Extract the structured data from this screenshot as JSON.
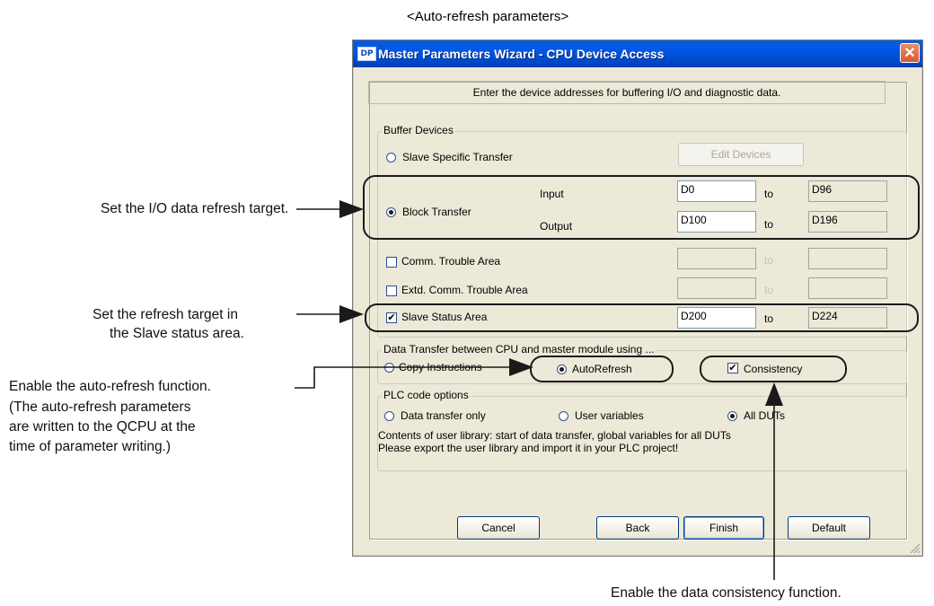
{
  "caption_top": "<Auto-refresh parameters>",
  "annotations": {
    "io_refresh": "Set the I/O data refresh target.",
    "slave_status_1": "Set the refresh target in",
    "slave_status_2": "the Slave status area.",
    "autorefresh_1": "Enable the auto-refresh function.",
    "autorefresh_2": "(The auto-refresh parameters",
    "autorefresh_3": "are written to the QCPU at the",
    "autorefresh_4": "time of parameter writing.)",
    "consistency": "Enable the data consistency function."
  },
  "window": {
    "badge": "DP",
    "title": "Master Parameters Wizard - CPU Device Access",
    "close": "✕"
  },
  "instruction": "Enter the device addresses for buffering I/O and diagnostic data.",
  "buffer_devices": {
    "label": "Buffer Devices",
    "slave_specific": "Slave Specific Transfer",
    "edit_devices": "Edit Devices",
    "block_transfer": "Block Transfer",
    "input_label": "Input",
    "output_label": "Output",
    "to": "to",
    "input_from": "D0",
    "input_to": "D96",
    "output_from": "D100",
    "output_to": "D196",
    "comm_trouble": "Comm. Trouble Area",
    "extd_comm_trouble": "Extd. Comm. Trouble Area",
    "slave_status": "Slave Status Area",
    "slave_status_from": "D200",
    "slave_status_to": "D224",
    "checked_mark": "✔"
  },
  "data_transfer": {
    "label": "Data Transfer between CPU and master module using ...",
    "copy_instructions": "Copy Instructions",
    "autorefresh": "AutoRefresh",
    "consistency": "Consistency"
  },
  "plc_code": {
    "label": "PLC code options",
    "data_transfer_only": "Data transfer only",
    "user_variables": "User variables",
    "all_duts": "All DUTs",
    "info_line1": "Contents of user library: start of data transfer, global variables for all DUTs",
    "info_line2": "Please export the user library and import it in your PLC project!"
  },
  "buttons": {
    "cancel": "Cancel",
    "back": "Back",
    "finish": "Finish",
    "default": "Default"
  }
}
